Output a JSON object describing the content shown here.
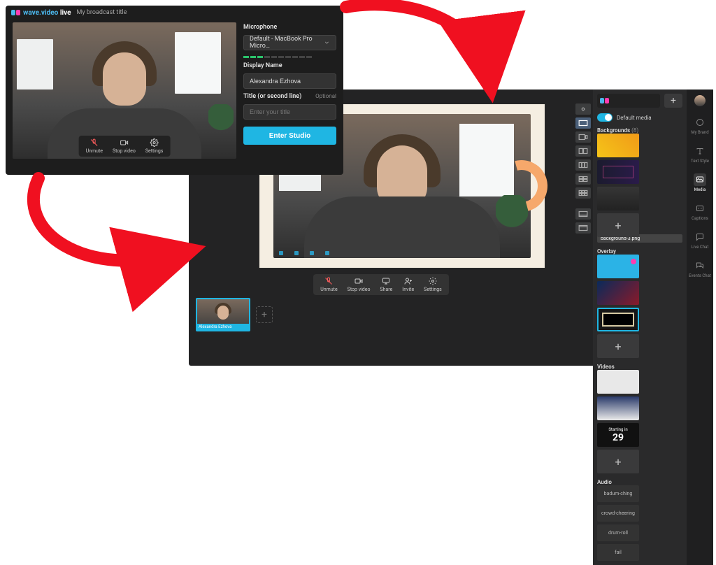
{
  "setup": {
    "brand": "wave.video",
    "brand_suffix": "live",
    "broadcast_title": "My broadcast title",
    "toolbar": {
      "unmute": "Unmute",
      "stop_video": "Stop video",
      "settings": "Settings"
    },
    "form": {
      "mic_label": "Microphone",
      "mic_value": "Default - MacBook Pro Micro…",
      "name_label": "Display Name",
      "name_value": "Alexandra Ezhova",
      "title_label": "Title (or second line)",
      "title_optional": "Optional",
      "title_placeholder": "Enter your title",
      "enter": "Enter Studio"
    }
  },
  "studio": {
    "toolbar": {
      "unmute": "Unmute",
      "stop_video": "Stop video",
      "share": "Share",
      "invite": "Invite",
      "settings": "Settings"
    },
    "thumb_name": "Alexandra Ezhova",
    "media": {
      "default_media": "Default media",
      "backgrounds": {
        "title": "Backgrounds",
        "count": "(8)",
        "tooltip": "background-3.png"
      },
      "overlay": {
        "title": "Overlay"
      },
      "videos": {
        "title": "Videos",
        "starting_in": "Starting in",
        "count": "29"
      },
      "audio": {
        "title": "Audio",
        "items": [
          "badum-ching",
          "crowd-cheering",
          "drum-roll",
          "fail"
        ]
      }
    },
    "rail": {
      "my_brand": "My Brand",
      "text_style": "Text Style",
      "media": "Media",
      "captions": "Captions",
      "live_chat": "Live Chat",
      "events_chat": "Events Chat"
    }
  }
}
